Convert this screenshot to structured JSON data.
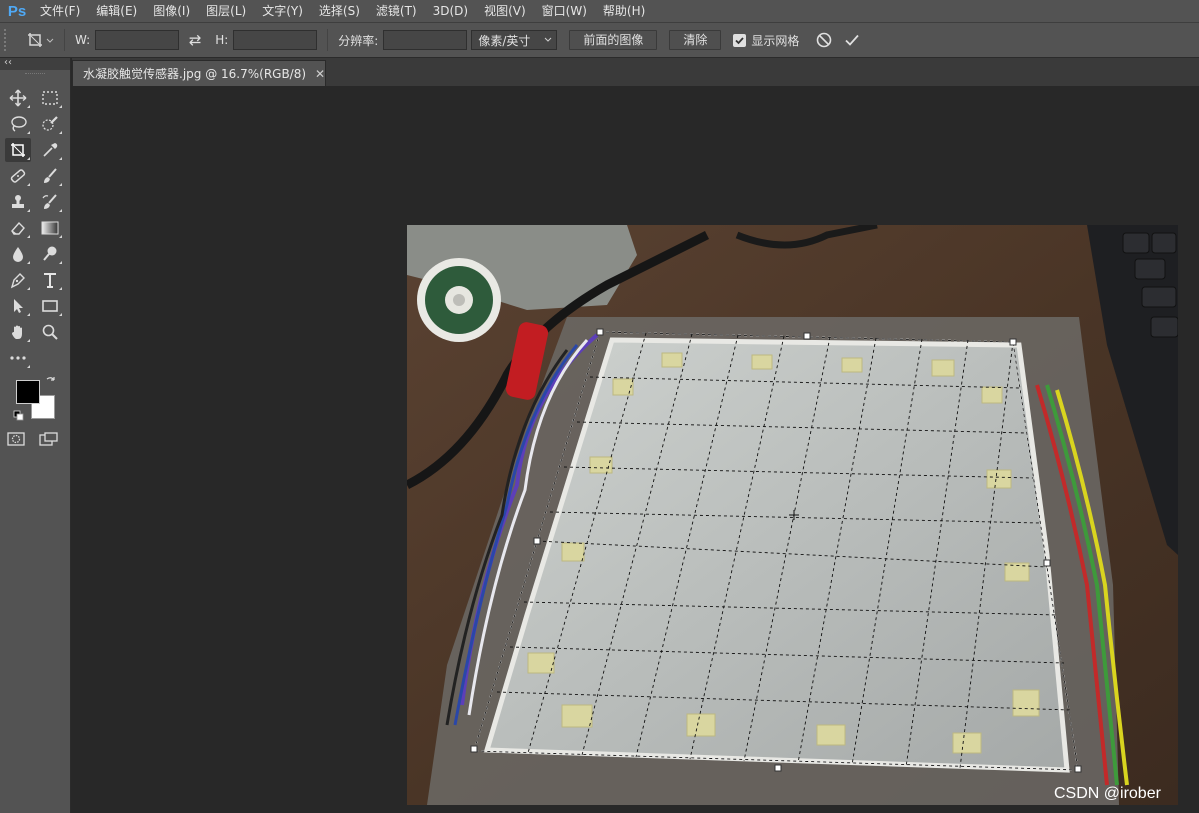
{
  "app": {
    "logo": "Ps"
  },
  "menu": [
    "文件(F)",
    "编辑(E)",
    "图像(I)",
    "图层(L)",
    "文字(Y)",
    "选择(S)",
    "滤镜(T)",
    "3D(D)",
    "视图(V)",
    "窗口(W)",
    "帮助(H)"
  ],
  "options": {
    "width_label": "W:",
    "width_value": "",
    "height_label": "H:",
    "height_value": "",
    "resolution_label": "分辨率:",
    "resolution_value": "",
    "unit_select": "像素/英寸",
    "front_image_button": "前面的图像",
    "clear_button": "清除",
    "show_grid_label": "显示网格",
    "show_grid_checked": true
  },
  "document": {
    "tab_title": "水凝胶触觉传感器.jpg @ 16.7%(RGB/8)"
  },
  "canvas": {
    "watermark": "CSDN @irober"
  },
  "colors": {
    "foreground": "#000000",
    "background": "#ffffff",
    "accent": "#4fa9f5"
  },
  "tools": [
    "move-tool",
    "marquee-tool",
    "lasso-tool",
    "quick-selection-tool",
    "perspective-crop-tool",
    "eyedropper-tool",
    "healing-brush-tool",
    "brush-tool",
    "clone-stamp-tool",
    "history-brush-tool",
    "eraser-tool",
    "gradient-tool",
    "blur-tool",
    "dodge-tool",
    "pen-tool",
    "type-tool",
    "path-selection-tool",
    "rectangle-tool",
    "hand-tool",
    "zoom-tool",
    "edit-toolbar"
  ]
}
